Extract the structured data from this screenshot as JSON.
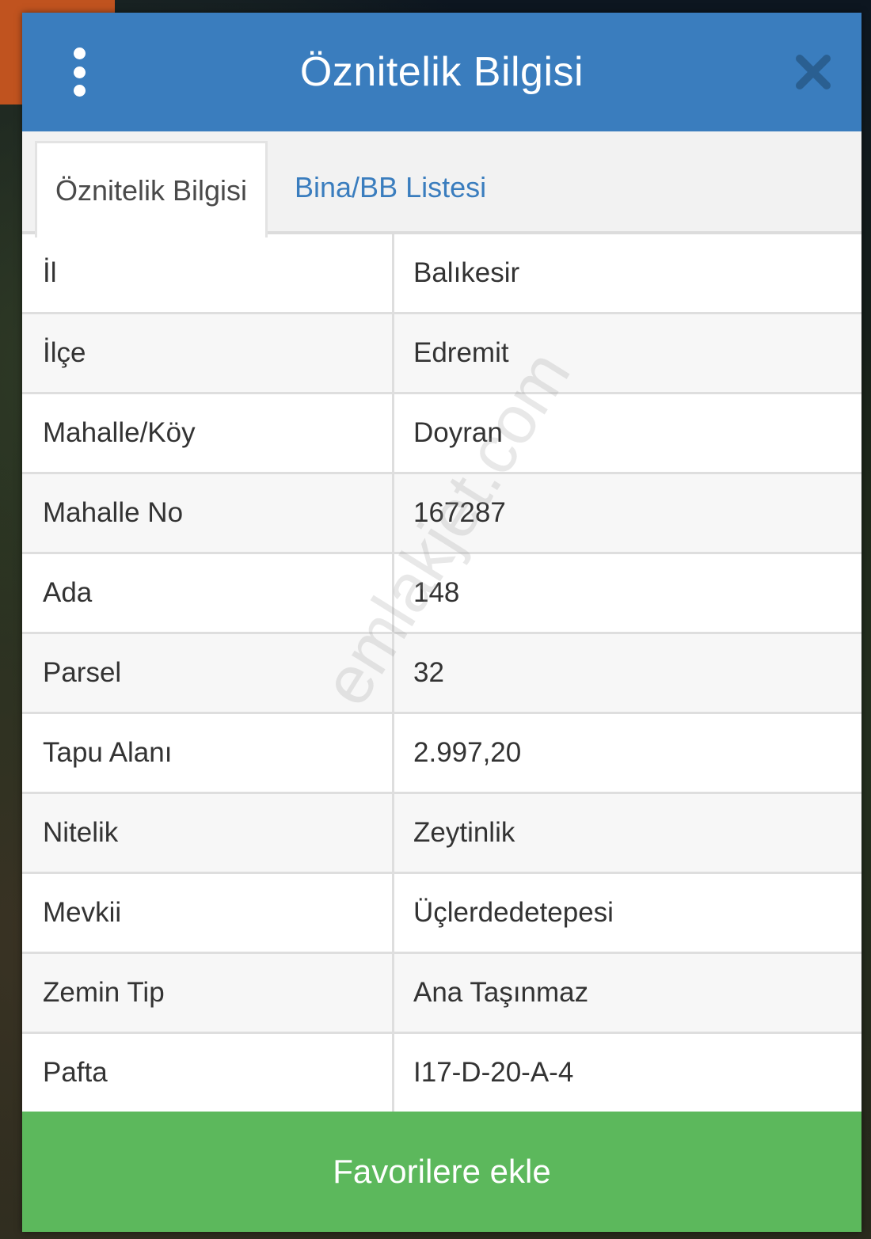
{
  "header": {
    "title": "Öznitelik Bilgisi"
  },
  "tabs": [
    {
      "label": "Öznitelik Bilgisi",
      "active": true
    },
    {
      "label": "Bina/BB Listesi",
      "active": false
    }
  ],
  "attributes": [
    {
      "key": "İl",
      "value": "Balıkesir"
    },
    {
      "key": "İlçe",
      "value": "Edremit"
    },
    {
      "key": "Mahalle/Köy",
      "value": "Doyran"
    },
    {
      "key": "Mahalle No",
      "value": "167287"
    },
    {
      "key": "Ada",
      "value": "148"
    },
    {
      "key": "Parsel",
      "value": "32"
    },
    {
      "key": "Tapu Alanı",
      "value": "2.997,20"
    },
    {
      "key": "Nitelik",
      "value": "Zeytinlik"
    },
    {
      "key": "Mevkii",
      "value": "Üçlerdedetepesi"
    },
    {
      "key": "Zemin Tip",
      "value": "Ana Taşınmaz"
    },
    {
      "key": "Pafta",
      "value": "I17-D-20-A-4"
    }
  ],
  "favorite_button": {
    "label": "Favorilere ekle"
  },
  "watermark": "emlakjet.com",
  "colors": {
    "header": "#3a7dbe",
    "tab_link": "#3a7dbe",
    "favorite": "#5cb85c",
    "close_icon": "#2a5f91"
  },
  "icons": {
    "menu": "vertical-dots-icon",
    "close": "close-icon"
  }
}
